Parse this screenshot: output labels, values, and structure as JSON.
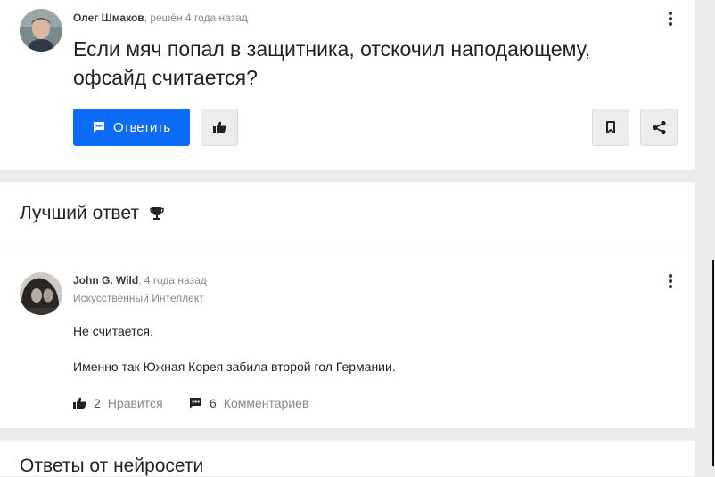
{
  "question": {
    "author": "Олег Шмаков",
    "meta": ", решён 4 года назад",
    "title": "Если мяч попал в защитника, отскочил наподающему, офсайд считается?",
    "answer_button_label": "Ответить"
  },
  "best_answer": {
    "section_title": "Лучший ответ",
    "author": "John G. Wild",
    "meta": ", 4 года назад",
    "rank": "Искусственный Интеллект",
    "text_lines": [
      "Не считается.",
      "Именно так Южная Корея забила второй гол Германии."
    ],
    "likes_count": "2",
    "likes_label": "Нравится",
    "comments_count": "6",
    "comments_label": "Комментариев"
  },
  "next_section": {
    "title": "Ответы от нейросети"
  },
  "icons": {
    "answer": "chat-bubble-icon",
    "like": "thumbs-up-icon",
    "bookmark": "bookmark-icon",
    "share": "share-icon",
    "more": "more-vertical-icon",
    "trophy": "trophy-icon",
    "comment": "comment-icon"
  },
  "colors": {
    "primary": "#0b6cf5",
    "background": "#ebebeb",
    "card": "#ffffff"
  }
}
